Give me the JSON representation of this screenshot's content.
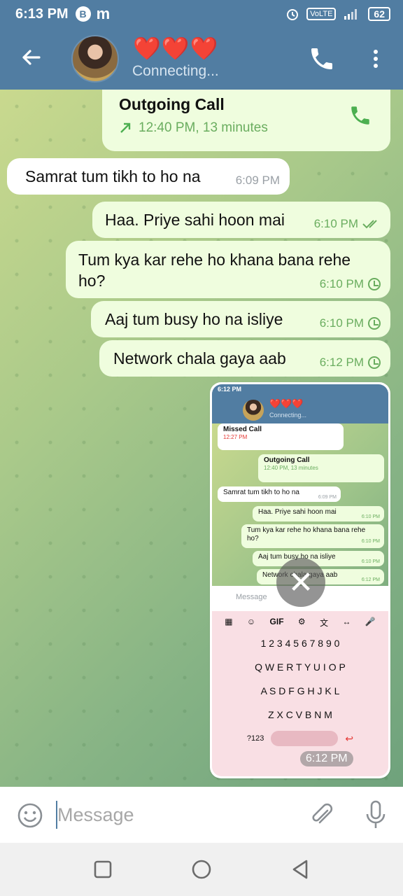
{
  "status_bar": {
    "time": "6:13 PM",
    "badge": "B",
    "app_letter": "m",
    "network": "VoLTE",
    "battery": "62"
  },
  "header": {
    "title": "❤️❤️❤️",
    "subtitle": "Connecting..."
  },
  "messages": [
    {
      "type": "call",
      "direction": "out",
      "title": "Outgoing Call",
      "info": "12:40 PM, 13 minutes"
    },
    {
      "type": "text",
      "direction": "in",
      "text": "Samrat tum tikh to ho na",
      "time": "6:09 PM"
    },
    {
      "type": "text",
      "direction": "out",
      "text": "Haa. Priye sahi hoon mai",
      "time": "6:10 PM",
      "status": "read"
    },
    {
      "type": "text",
      "direction": "out",
      "text": "Tum kya kar rehe ho khana bana rehe ho?",
      "time": "6:10 PM",
      "status": "pending"
    },
    {
      "type": "text",
      "direction": "out",
      "text": "Aaj tum busy ho na isliye",
      "time": "6:10 PM",
      "status": "pending"
    },
    {
      "type": "text",
      "direction": "out",
      "text": "Network chala gaya aab",
      "time": "6:12 PM",
      "status": "pending"
    }
  ],
  "screenshot": {
    "time": "6:12 PM",
    "status_time": "6:12 PM",
    "title": "❤️❤️❤️",
    "subtitle": "Connecting...",
    "missed_title": "Missed Call",
    "missed_time": "12:27 PM",
    "out_title": "Outgoing Call",
    "out_info": "12:40 PM, 13 minutes",
    "msg1": "Samrat tum tikh to ho na",
    "msg1_time": "6:09 PM",
    "msg2": "Haa. Priye sahi hoon mai",
    "msg2_time": "6:10 PM",
    "msg3": "Tum kya kar rehe ho khana bana rehe ho?",
    "msg3_time": "6:10 PM",
    "msg4": "Aaj tum busy ho na isliye",
    "msg4_time": "6:10 PM",
    "msg5": "Network chala gaya aab",
    "msg5_time": "6:12 PM",
    "input_placeholder": "Message",
    "kb_gif": "GIF",
    "kb_row1": "1 2 3 4 5 6 7 8 9 0",
    "kb_row2": "Q W E R T Y U I O P",
    "kb_row3": "A S D F G H J K L",
    "kb_row4": "Z X C V B N M",
    "kb_123": "?123"
  },
  "input": {
    "placeholder": "Message"
  },
  "colors": {
    "header": "#517da2",
    "outgoing_bubble": "#effdde",
    "incoming_bubble": "#ffffff",
    "accent_green": "#6aad5f"
  }
}
